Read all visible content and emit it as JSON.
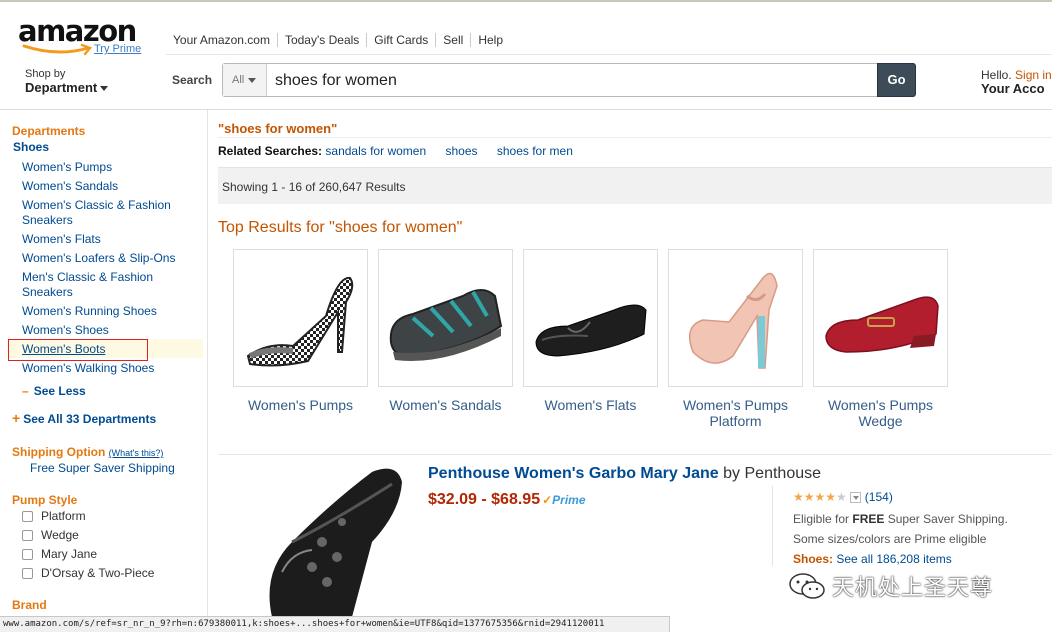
{
  "header": {
    "logo": "amazon",
    "try_prime": "Try Prime",
    "nav": [
      "Your Amazon.com",
      "Today's Deals",
      "Gift Cards",
      "Sell",
      "Help"
    ],
    "shop_by": "Shop by",
    "department": "Department",
    "search_label": "Search",
    "search_category": "All",
    "search_value": "shoes for women",
    "go": "Go",
    "hello": "Hello.",
    "sign_in": "Sign in",
    "your_account": "Your Acco"
  },
  "sidebar": {
    "departments": "Departments",
    "shoes": "Shoes",
    "items": [
      "Women's Pumps",
      "Women's Sandals",
      "Women's Classic & Fashion Sneakers",
      "Women's Flats",
      "Women's Loafers & Slip-Ons",
      "Men's Classic & Fashion Sneakers",
      "Women's Running Shoes",
      "Women's Shoes",
      "Women's Boots",
      "Women's Walking Shoes"
    ],
    "see_less": "See Less",
    "see_all": "See All 33 Departments",
    "shipping_option": "Shipping Option",
    "whats_this": "(What's this?)",
    "free_shipping": "Free Super Saver Shipping",
    "pump_style": "Pump Style",
    "pump_styles": [
      "Platform",
      "Wedge",
      "Mary Jane",
      "D'Orsay & Two-Piece"
    ],
    "brand": "Brand"
  },
  "main": {
    "query": "\"shoes for women\"",
    "related_label": "Related Searches:",
    "related": [
      "sandals for women",
      "shoes",
      "shoes for men"
    ],
    "showing": "Showing 1 - 16 of 260,647 Results",
    "top_results": "Top Results for \"shoes for women\"",
    "tiles": [
      {
        "label": "Women's Pumps"
      },
      {
        "label": "Women's Sandals"
      },
      {
        "label": "Women's Flats"
      },
      {
        "label": "Women's Pumps Platform"
      },
      {
        "label": "Women's Pumps Wedge"
      }
    ]
  },
  "product": {
    "title": "Penthouse Women's Garbo Mary Jane",
    "by": "by Penthouse",
    "price": "$32.09 - $68.95",
    "prime": "Prime",
    "rating": 4.5,
    "reviews": "(154)",
    "eligible_pre": "Eligible for",
    "eligible_bold": "FREE",
    "eligible_post": "Super Saver Shipping.",
    "sizes": "Some sizes/colors are Prime eligible",
    "shoes_label": "Shoes:",
    "shoes_link": "See all 186,208 items"
  },
  "watermark": "天机处上圣天尊",
  "status_url": "www.amazon.com/s/ref=sr_nr_n_9?rh=n:679380011,k:shoes+...shoes+for+women&ie=UTF8&qid=1377675356&rnid=2941120011",
  "colors": {
    "accent": "#e47911",
    "link": "#004b91",
    "price": "#b12704",
    "go": "#3e4c5a"
  }
}
